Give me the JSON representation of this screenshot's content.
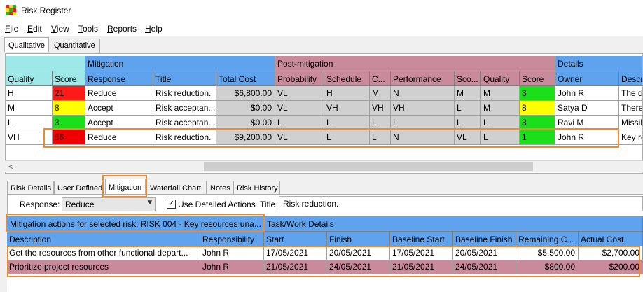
{
  "window": {
    "title": "Risk Register"
  },
  "colors": {
    "header_blue": "#5fa3ef",
    "post_pink": "#c98a9b",
    "group_cyan": "#9fe8e8",
    "highlight": "#f08a2e"
  },
  "menu": [
    "File",
    "Edit",
    "View",
    "Tools",
    "Reports",
    "Help"
  ],
  "outer_tabs": [
    "Qualitative",
    "Quantitative"
  ],
  "grid": {
    "groups": {
      "mitigation": "Mitigation",
      "post": "Post-mitigation",
      "details": "Details"
    },
    "headers": [
      "Quality",
      "Score",
      "Response",
      "Title",
      "Total Cost",
      "Probability",
      "Schedule",
      "C...",
      "Performance",
      "Sco...",
      "Quality",
      "Score",
      "Owner",
      "Descr"
    ],
    "rows": [
      {
        "quality": "H",
        "score": "21",
        "response": "Reduce",
        "title": "Risk reduction.",
        "cost": "$6,800.00",
        "prob": "VL",
        "sched": "H",
        "c": "M",
        "perf": "N",
        "sco": "M",
        "qual2": "M",
        "score2": "3",
        "owner": "John R",
        "descr": "The de"
      },
      {
        "quality": "M",
        "score": "8",
        "response": "Accept",
        "title": "Risk acceptan...",
        "cost": "$0.00",
        "prob": "VL",
        "sched": "VH",
        "c": "VH",
        "perf": "VH",
        "sco": "L",
        "qual2": "M",
        "score2": "8",
        "owner": "Satya D",
        "descr": "There"
      },
      {
        "quality": "L",
        "score": "3",
        "response": "Accept",
        "title": "Risk acceptan...",
        "cost": "$0.00",
        "prob": "L",
        "sched": "L",
        "c": "L",
        "perf": "L",
        "sco": "L",
        "qual2": "L",
        "score2": "3",
        "owner": "Ravi M",
        "descr": "Missil"
      },
      {
        "quality": "VH",
        "score": "56",
        "response": "Reduce",
        "title": "Risk reduction.",
        "cost": "$9,200.00",
        "prob": "VL",
        "sched": "L",
        "c": "L",
        "perf": "N",
        "sco": "VL",
        "qual2": "L",
        "score2": "1",
        "owner": "John R",
        "descr": "Key re"
      }
    ]
  },
  "inner_tabs": [
    "Risk Details",
    "User Defined",
    "Mitigation",
    "Waterfall Chart",
    "Notes",
    "Risk History"
  ],
  "mitigation": {
    "response_label": "Response:",
    "response_value": "Reduce",
    "detailed_label": "Use Detailed Actions",
    "detailed_checked": "✓",
    "title_label": "Title",
    "title_value": "Risk reduction.",
    "actions_group": "Mitigation actions for selected risk: RISK 004 - Key resources una...",
    "task_group": "Task/Work Details",
    "headers": [
      "Description",
      "Responsibility",
      "Start",
      "Finish",
      "Baseline Start",
      "Baseline Finish",
      "Remaining C...",
      "Actual Cost"
    ],
    "rows": [
      {
        "desc": "Get the resources from other functional depart...",
        "resp": "John R",
        "start": "17/05/2021",
        "finish": "20/05/2021",
        "bstart": "17/05/2021",
        "bfinish": "20/05/2021",
        "remaining": "$5,500.00",
        "actual": "$2,700.00"
      },
      {
        "desc": "Prioritize project resources",
        "resp": "John R",
        "start": "21/05/2021",
        "finish": "24/05/2021",
        "bstart": "21/05/2021",
        "bfinish": "24/05/2021",
        "remaining": "$800.00",
        "actual": "$200.00"
      }
    ]
  }
}
